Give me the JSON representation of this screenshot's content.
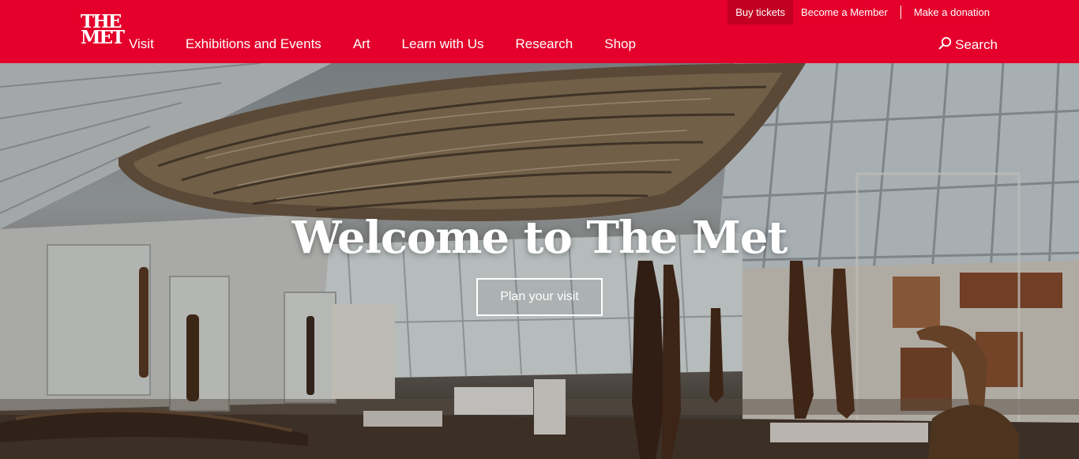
{
  "brand": {
    "logo_line1": "THE",
    "logo_line2": "MET",
    "accent": "#e4002b"
  },
  "nav": {
    "items": [
      {
        "label": "Visit"
      },
      {
        "label": "Exhibitions and Events"
      },
      {
        "label": "Art"
      },
      {
        "label": "Learn with Us"
      },
      {
        "label": "Research"
      },
      {
        "label": "Shop"
      }
    ]
  },
  "utility": {
    "buy_tickets": "Buy tickets",
    "become_member": "Become a Member",
    "donate": "Make a donation"
  },
  "search": {
    "label": "Search",
    "icon": "search-icon"
  },
  "hero": {
    "headline": "Welcome to The Met",
    "cta_label": "Plan your visit"
  }
}
